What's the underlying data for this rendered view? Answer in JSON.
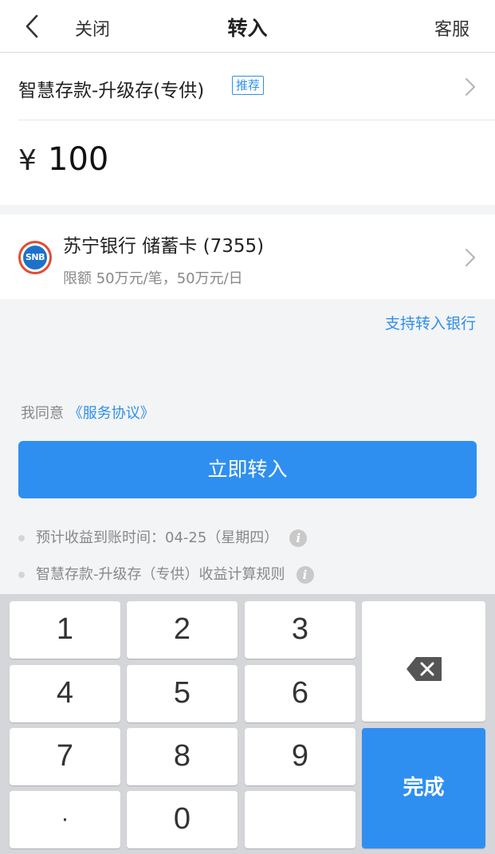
{
  "nav": {
    "close": "关闭",
    "title": "转入",
    "service": "客服"
  },
  "product": {
    "name": "智慧存款-升级存(专供)",
    "tag": "推荐"
  },
  "amount": {
    "currency": "¥",
    "value": "100"
  },
  "bank": {
    "logo_text": "SNB",
    "name": "苏宁银行 储蓄卡 (7355)",
    "limit": "限额 50万元/笔，50万元/日"
  },
  "support_link": "支持转入银行",
  "agreement": {
    "prefix": "我同意 ",
    "link": "《服务协议》"
  },
  "submit_label": "立即转入",
  "notes": [
    "预计收益到账时间：04-25（星期四）",
    "智慧存款-升级存（专供）收益计算规则"
  ],
  "keypad": {
    "keys": [
      "1",
      "2",
      "3",
      "4",
      "5",
      "6",
      "7",
      "8",
      "9",
      "·",
      "0",
      ""
    ],
    "done_label": "完成"
  },
  "colors": {
    "accent": "#2f8ff0",
    "link": "#2f8fe8",
    "logo_ring": "#e64a2e",
    "logo_fill": "#1c72c9"
  }
}
